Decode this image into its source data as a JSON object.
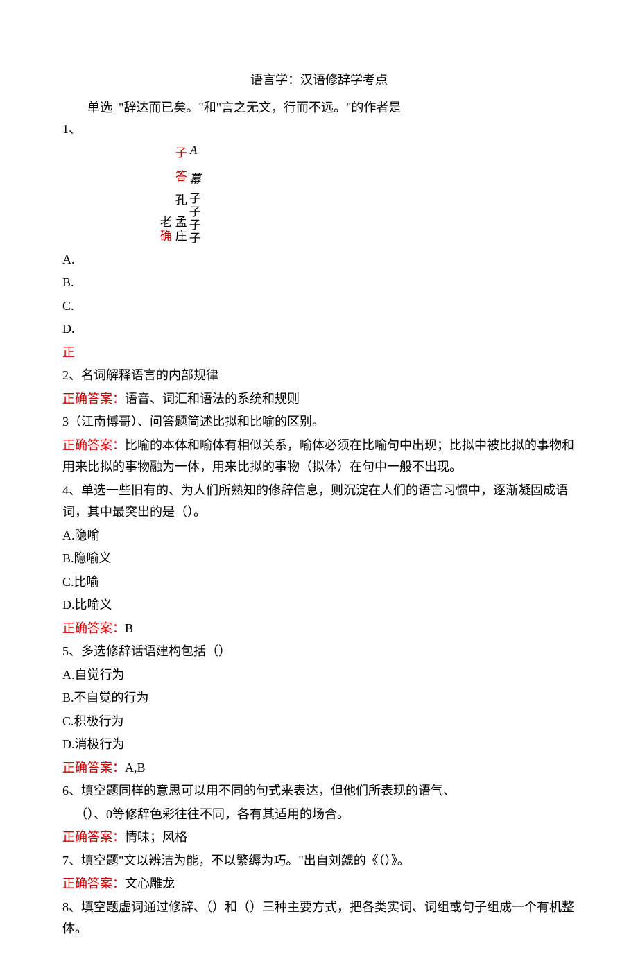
{
  "title": "语言学：汉语修辞学考点",
  "q1": {
    "stem_prefix": "单选",
    "stem": "\"辞达而已矣。\"和\"言之无文，行而不远。\"的作者是",
    "number": "1、",
    "vertical": {
      "col1_top": "子",
      "col1_bottom": "答",
      "col2": "A 幕",
      "col3": "孔",
      "col4_top": "老",
      "col4_mid": "孟",
      "col4_bottom": "确",
      "col5": "子子",
      "col6": "庄",
      "col7": "子子"
    },
    "options": {
      "a": "A.",
      "b": "B.",
      "c": "C.",
      "d": "D."
    },
    "zheng": "正"
  },
  "q2": {
    "stem": "2、名词解释语言的内部规律",
    "answer_label": "正确答案：",
    "answer": "语音、词汇和语法的系统和规则"
  },
  "q3": {
    "stem": "3（江南博哥）、问答题简述比拟和比喻的区别。",
    "answer_label": "正确答案：",
    "answer": "比喻的本体和喻体有相似关系，喻体必须在比喻句中出现；比拟中被比拟的事物和用来比拟的事物融为一体，用来比拟的事物（拟体）在句中一般不出现。"
  },
  "q4": {
    "stem": "4、单选一些旧有的、为人们所熟知的修辞信息，则沉淀在人们的语言习惯中，逐渐凝固成语词，其中最突出的是（）。",
    "options": {
      "a": "A.隐喻",
      "b": "B.隐喻义",
      "c": "C.比喻",
      "d": "D.比喻义"
    },
    "answer_label": "正确答案：",
    "answer": "B"
  },
  "q5": {
    "stem": "5、多选修辞话语建构包括（）",
    "options": {
      "a": "A.自觉行为",
      "b": "B.不自觉的行为",
      "c": "C.积极行为",
      "d": "D.消极行为"
    },
    "answer_label": "正确答案：",
    "answer": "A,B"
  },
  "q6": {
    "stem": "6、填空题同样的意思可以用不同的句式来表达，但他们所表现的语气、",
    "stem2": "（）、0等修辞色彩往往不同，各有其适用的场合。",
    "answer_label": "正确答案：",
    "answer": "情味；风格"
  },
  "q7": {
    "stem": "7、填空题\"文以辨洁为能，不以繁缛为巧。\"出自刘勰的《（）》。",
    "answer_label": "正确答案：",
    "answer": "文心雕龙"
  },
  "q8": {
    "stem": "8、填空题虚词通过修辞、（）和（）三种主要方式，把各类实词、词组或句子组成一个有机整体。"
  }
}
